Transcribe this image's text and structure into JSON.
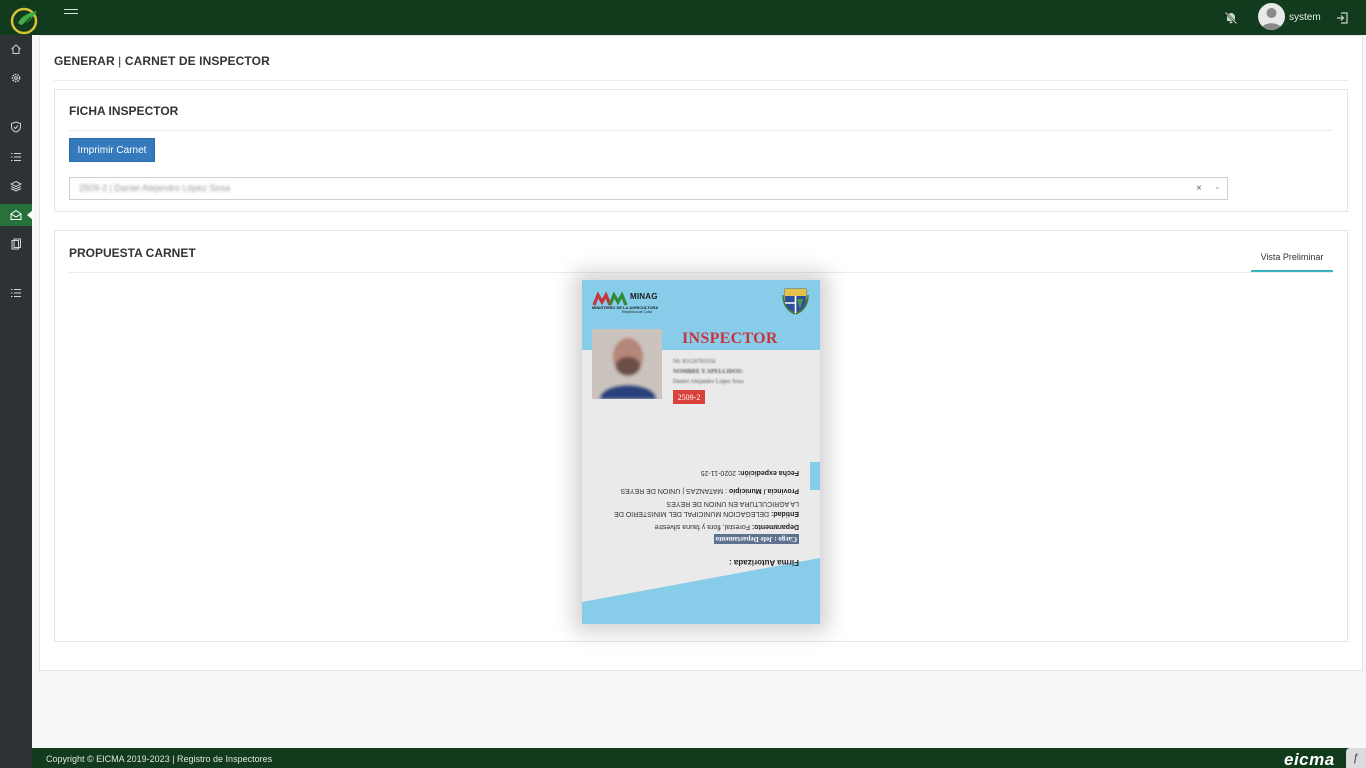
{
  "topbar": {
    "username": "system",
    "icons": [
      "app-logo-icon",
      "menu-icon",
      "notifications-off-icon",
      "user-avatar-icon",
      "logout-icon"
    ]
  },
  "sidebar": {
    "items": [
      {
        "name": "home",
        "icon": "home-icon"
      },
      {
        "name": "settings",
        "icon": "gear-icon"
      },
      {
        "name": "security",
        "icon": "shield-icon"
      },
      {
        "name": "list",
        "icon": "list-icon"
      },
      {
        "name": "layers",
        "icon": "layers-icon"
      },
      {
        "name": "inspector-card",
        "icon": "envelope-open-icon",
        "active": true
      },
      {
        "name": "documents",
        "icon": "clipboard-icon"
      },
      {
        "name": "list-2",
        "icon": "list-icon"
      }
    ]
  },
  "page": {
    "title_left": "GENERAR",
    "title_sep": " | ",
    "title_right": "CARNET DE INSPECTOR"
  },
  "ficha": {
    "title": "FICHA INSPECTOR",
    "print_button": "Imprimir Carnet",
    "select_value": "2509-2 | Daniel Alejandro López Sosa",
    "clear_symbol": "×",
    "arrow_symbol": "⌄"
  },
  "propuesta": {
    "title": "PROPUESTA CARNET",
    "tab": "Vista Preliminar"
  },
  "idcard": {
    "org_short": "MINAG",
    "org_long": "MINISTERIO DE LA AGRICULTURA",
    "country": "República de Cuba",
    "heading": "INSPECTOR",
    "ni_line": "NI: 83120703356",
    "name_label": "NOMBRE Y APELLIDOS:",
    "name_value": "Daniel Alejandro López Sosa",
    "code": "2509-2",
    "fecha_label": "Fecha expedición:",
    "fecha_value": " 2020-11-25",
    "provincia_label": "Provincia / Municipio",
    "provincia_value": " : MATANZAS | UNION DE REYES",
    "entidad_label": "Entidad:",
    "entidad_value": " DELEGACION MUNICIPAL DEL MINISTERIO DE",
    "entidad_value2": "LA AGRICULTURA EN UNION DE REYES",
    "depto_label": "Deparamento:",
    "depto_value": " Forestal, flora y fauna silvestre",
    "cargo": "Cargo : Jefe Departamento",
    "firma": "Firma Autorizada :"
  },
  "footer": {
    "copyright": "Copyright © EICMA 2019-2023 | Registro de Inspectores",
    "brand": "eicma",
    "corner_icon": "symfony-icon"
  },
  "colors": {
    "topbar": "#123a1c",
    "sidebar": "#2d3236",
    "sidebar_active": "#27723a",
    "primary_button": "#357abd",
    "card_blue": "#87cdea",
    "inspector_red": "#c8343c",
    "tab_underline": "#3ab4bf"
  }
}
